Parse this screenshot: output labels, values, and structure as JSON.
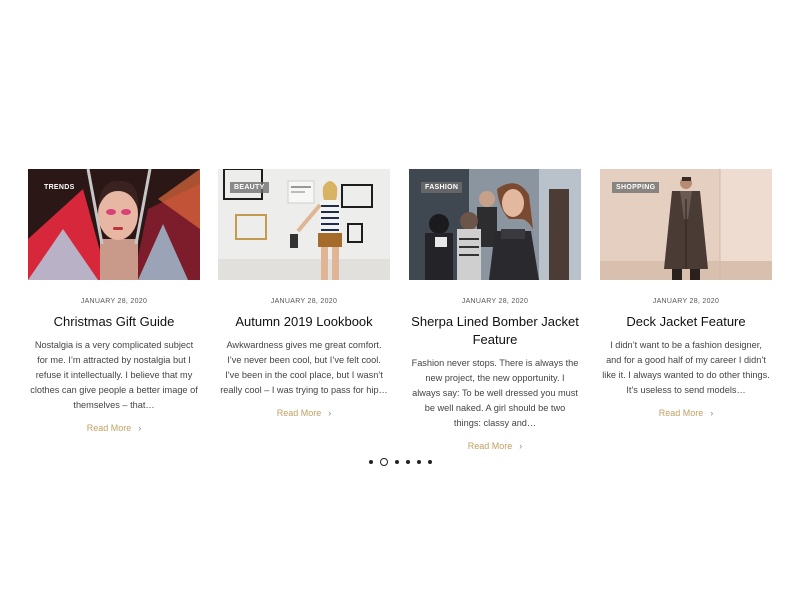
{
  "carousel": {
    "cards": [
      {
        "tag": "TRENDS",
        "date": "JANUARY 28, 2020",
        "title": "Christmas Gift Guide",
        "excerpt": "Nostalgia is a very complicated subject for me. I’m attracted by nostalgia but I refuse it intellectually. I believe that my clothes can give people a better image of themselves – that…",
        "read_more": "Read More"
      },
      {
        "tag": "BEAUTY",
        "date": "JANUARY 28, 2020",
        "title": "Autumn 2019 Lookbook",
        "excerpt": "Awkwardness gives me great comfort. I’ve never been cool, but I’ve felt cool. I’ve been in the cool place, but I wasn’t really cool – I was trying to pass for hip…",
        "read_more": "Read More"
      },
      {
        "tag": "FASHION",
        "date": "JANUARY 28, 2020",
        "title": "Sherpa Lined Bomber Jacket Feature",
        "excerpt": "Fashion never stops. There is always the new project, the new opportunity. I always say: To be well dressed you must be well naked. A girl should be two things: classy and…",
        "read_more": "Read More"
      },
      {
        "tag": "SHOPPING",
        "date": "JANUARY 28, 2020",
        "title": "Deck Jacket Feature",
        "excerpt": "I didn’t want to be a fashion designer, and for a good half of my career I didn’t like it. I always wanted to do other things. It’s useless to send models…",
        "read_more": "Read More"
      }
    ],
    "pagination": {
      "count": 6,
      "active_index": 1
    }
  },
  "colors": {
    "accent_link": "#c0a062",
    "text_dark": "#111111",
    "text_body": "#444444"
  },
  "icons": {
    "read_more_arrow": "chevron-right-icon"
  }
}
